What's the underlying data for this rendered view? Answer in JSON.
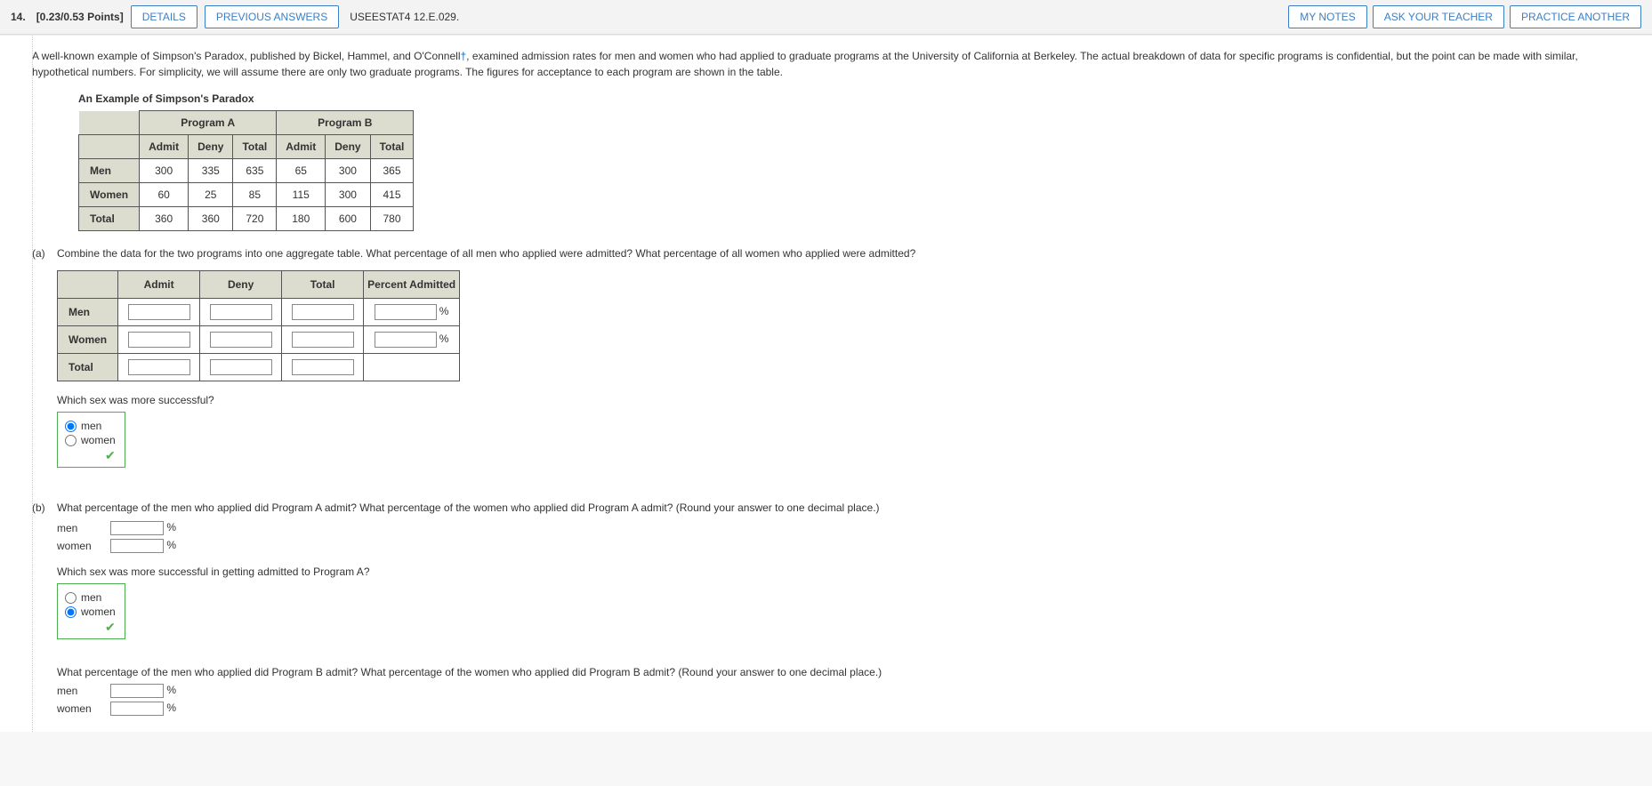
{
  "header": {
    "qnum": "14.",
    "points": "[0.23/0.53 Points]",
    "details": "DETAILS",
    "previous": "PREVIOUS ANSWERS",
    "ref": "USEESTAT4 12.E.029.",
    "mynotes": "MY NOTES",
    "ask": "ASK YOUR TEACHER",
    "practice": "PRACTICE ANOTHER"
  },
  "intro": "A well-known example of Simpson's Paradox, published by Bickel, Hammel, and O'Connell",
  "intro2": ", examined admission rates for men and women who had applied to graduate programs at the University of California at Berkeley. The actual breakdown of data for specific programs is confidential, but the point can be made with similar, hypothetical numbers. For simplicity, we will assume there are only two graduate programs. The figures for acceptance to each program are shown in the table.",
  "table1": {
    "title": "An Example of Simpson's Paradox",
    "progA": "Program A",
    "progB": "Program B",
    "admit": "Admit",
    "deny": "Deny",
    "total": "Total",
    "rows": {
      "men": {
        "label": "Men",
        "a": [
          "300",
          "335",
          "635"
        ],
        "b": [
          "65",
          "300",
          "365"
        ]
      },
      "women": {
        "label": "Women",
        "a": [
          "60",
          "25",
          "85"
        ],
        "b": [
          "115",
          "300",
          "415"
        ]
      },
      "total": {
        "label": "Total",
        "a": [
          "360",
          "360",
          "720"
        ],
        "b": [
          "180",
          "600",
          "780"
        ]
      }
    }
  },
  "partA": {
    "label": "(a)",
    "text": "Combine the data for the two programs into one aggregate table. What percentage of all men who applied were admitted? What percentage of all women who applied were admitted?",
    "cols": {
      "admit": "Admit",
      "deny": "Deny",
      "total": "Total",
      "pct": "Percent Admitted"
    },
    "rows": {
      "men": "Men",
      "women": "Women",
      "total": "Total"
    },
    "pct": "%",
    "subq": "Which sex was more successful?",
    "opt1": "men",
    "opt2": "women"
  },
  "partB": {
    "label": "(b)",
    "text": "What percentage of the men who applied did Program A admit? What percentage of the women who applied did Program A admit? (Round your answer to one decimal place.)",
    "men": "men",
    "women": "women",
    "pct": "%",
    "subq": "Which sex was more successful in getting admitted to Program A?",
    "opt1": "men",
    "opt2": "women",
    "text2": "What percentage of the men who applied did Program B admit? What percentage of the women who applied did Program B admit? (Round your answer to one decimal place.)"
  }
}
